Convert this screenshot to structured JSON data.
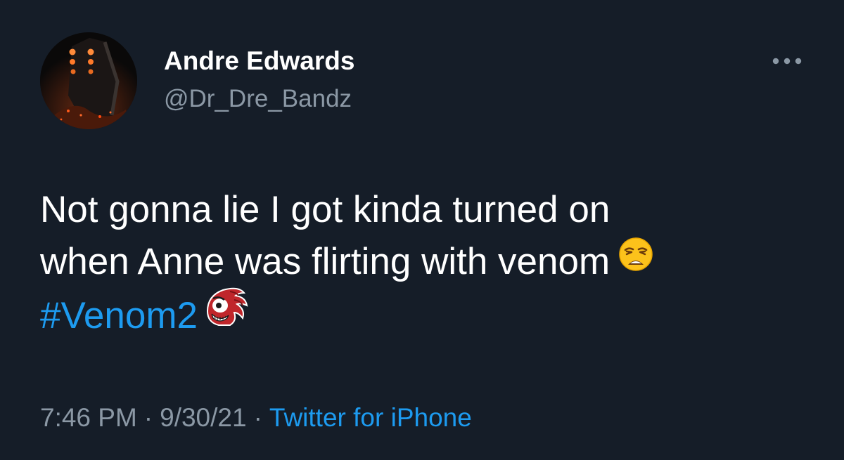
{
  "user": {
    "display_name": "Andre Edwards",
    "handle": "@Dr_Dre_Bandz",
    "avatar_icon": "profile-photo"
  },
  "more_icon": "more-options-icon",
  "tweet": {
    "line1": "Not gonna lie I got kinda turned on",
    "line2": "when Anne was flirting with venom",
    "hashtag": "#Venom2",
    "emoji_icon": "weary-face-emoji",
    "sticker_icon": "knuckles-emoji"
  },
  "meta": {
    "time": "7:46 PM",
    "date": "9/30/21",
    "separator": "·",
    "source": "Twitter for iPhone"
  },
  "colors": {
    "background": "#151d28",
    "text": "#ffffff",
    "secondary": "#8b98a5",
    "link": "#1d9bf0"
  }
}
